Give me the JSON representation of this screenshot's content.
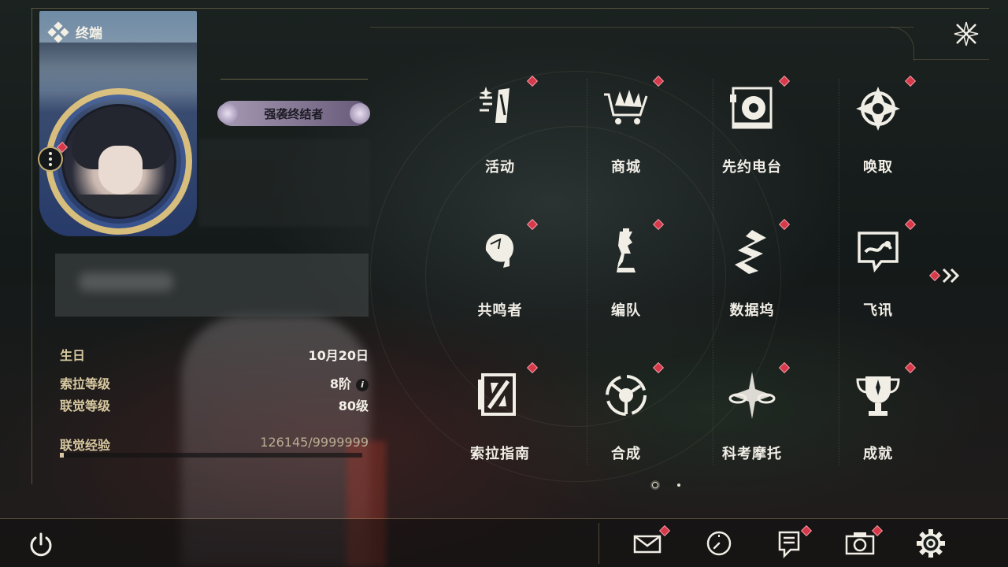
{
  "header": {
    "title": "终端"
  },
  "profile": {
    "title_badge": "强袭终结者",
    "info": [
      {
        "key": "生日",
        "value": "10月20日"
      },
      {
        "key": "索拉等级",
        "value": "8阶"
      },
      {
        "key": "联觉等级",
        "value": "80级"
      }
    ],
    "exp_label": "联觉经验",
    "exp_value": "126145/9999999",
    "exp_fraction": 0.0126
  },
  "menu": {
    "items": [
      {
        "label": "活动",
        "icon": "activity-icon"
      },
      {
        "label": "商城",
        "icon": "shop-cart-icon"
      },
      {
        "label": "先约电台",
        "icon": "radio-icon"
      },
      {
        "label": "唤取",
        "icon": "convene-icon"
      },
      {
        "label": "共鸣者",
        "icon": "resonator-icon"
      },
      {
        "label": "编队",
        "icon": "chess-team-icon"
      },
      {
        "label": "数据坞",
        "icon": "data-bank-icon"
      },
      {
        "label": "飞讯",
        "icon": "chat-icon"
      },
      {
        "label": "索拉指南",
        "icon": "guidebook-icon"
      },
      {
        "label": "合成",
        "icon": "synthesis-icon"
      },
      {
        "label": "科考摩托",
        "icon": "motorcycle-icon"
      },
      {
        "label": "成就",
        "icon": "trophy-icon"
      }
    ],
    "page_current": 1,
    "page_total": 2
  },
  "bottom_bar": {
    "icons": [
      "power-icon",
      "mail-icon",
      "clock-icon",
      "notice-icon",
      "camera-icon",
      "settings-gear-icon"
    ]
  },
  "colors": {
    "accent_gold": "#d8c9a0",
    "notification_red": "#d8394a",
    "text_light": "#f1eee6"
  }
}
